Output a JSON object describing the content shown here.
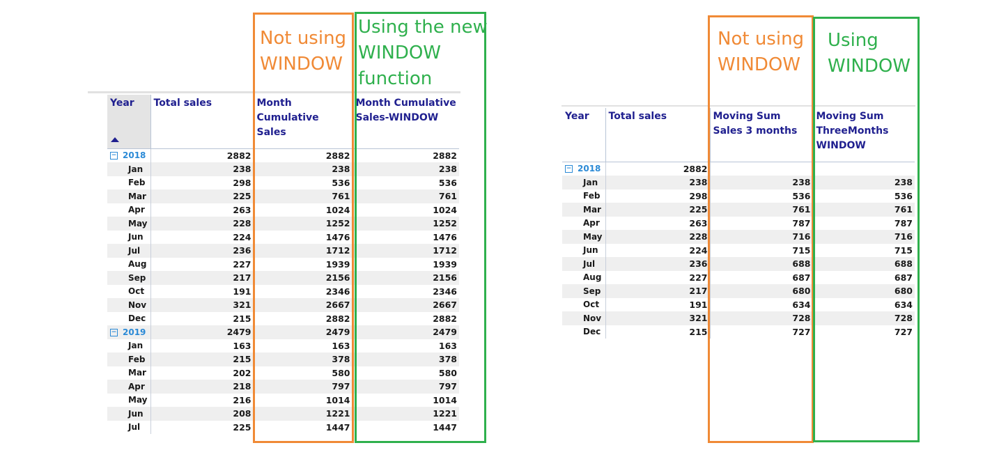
{
  "left": {
    "annotation_orange": [
      "Not using",
      "WINDOW"
    ],
    "annotation_green": [
      "Using the new",
      "WINDOW",
      "function"
    ],
    "headers": [
      "Year",
      "Total sales",
      "Month Cumulative Sales",
      "Month Cumulative Sales-WINDOW"
    ],
    "rows": [
      {
        "type": "year",
        "label": "2018",
        "values": [
          "2882",
          "2882",
          "2882"
        ]
      },
      {
        "type": "month",
        "label": "Jan",
        "values": [
          "238",
          "238",
          "238"
        ]
      },
      {
        "type": "month",
        "label": "Feb",
        "values": [
          "298",
          "536",
          "536"
        ]
      },
      {
        "type": "month",
        "label": "Mar",
        "values": [
          "225",
          "761",
          "761"
        ]
      },
      {
        "type": "month",
        "label": "Apr",
        "values": [
          "263",
          "1024",
          "1024"
        ]
      },
      {
        "type": "month",
        "label": "May",
        "values": [
          "228",
          "1252",
          "1252"
        ]
      },
      {
        "type": "month",
        "label": "Jun",
        "values": [
          "224",
          "1476",
          "1476"
        ]
      },
      {
        "type": "month",
        "label": "Jul",
        "values": [
          "236",
          "1712",
          "1712"
        ]
      },
      {
        "type": "month",
        "label": "Aug",
        "values": [
          "227",
          "1939",
          "1939"
        ]
      },
      {
        "type": "month",
        "label": "Sep",
        "values": [
          "217",
          "2156",
          "2156"
        ]
      },
      {
        "type": "month",
        "label": "Oct",
        "values": [
          "191",
          "2346",
          "2346"
        ]
      },
      {
        "type": "month",
        "label": "Nov",
        "values": [
          "321",
          "2667",
          "2667"
        ]
      },
      {
        "type": "month",
        "label": "Dec",
        "values": [
          "215",
          "2882",
          "2882"
        ]
      },
      {
        "type": "year",
        "label": "2019",
        "values": [
          "2479",
          "2479",
          "2479"
        ]
      },
      {
        "type": "month",
        "label": "Jan",
        "values": [
          "163",
          "163",
          "163"
        ]
      },
      {
        "type": "month",
        "label": "Feb",
        "values": [
          "215",
          "378",
          "378"
        ]
      },
      {
        "type": "month",
        "label": "Mar",
        "values": [
          "202",
          "580",
          "580"
        ]
      },
      {
        "type": "month",
        "label": "Apr",
        "values": [
          "218",
          "797",
          "797"
        ]
      },
      {
        "type": "month",
        "label": "May",
        "values": [
          "216",
          "1014",
          "1014"
        ]
      },
      {
        "type": "month",
        "label": "Jun",
        "values": [
          "208",
          "1221",
          "1221"
        ]
      },
      {
        "type": "month",
        "label": "Jul",
        "values": [
          "225",
          "1447",
          "1447"
        ]
      }
    ]
  },
  "right": {
    "annotation_orange": [
      "Not using",
      "WINDOW"
    ],
    "annotation_green": [
      "Using",
      "WINDOW"
    ],
    "headers": [
      "Year",
      "Total sales",
      "Moving Sum Sales 3 months",
      "Moving Sum ThreeMonths WINDOW"
    ],
    "rows": [
      {
        "type": "year",
        "label": "2018",
        "values": [
          "2882",
          "",
          ""
        ]
      },
      {
        "type": "month",
        "label": "Jan",
        "values": [
          "238",
          "238",
          "238"
        ]
      },
      {
        "type": "month",
        "label": "Feb",
        "values": [
          "298",
          "536",
          "536"
        ]
      },
      {
        "type": "month",
        "label": "Mar",
        "values": [
          "225",
          "761",
          "761"
        ]
      },
      {
        "type": "month",
        "label": "Apr",
        "values": [
          "263",
          "787",
          "787"
        ]
      },
      {
        "type": "month",
        "label": "May",
        "values": [
          "228",
          "716",
          "716"
        ]
      },
      {
        "type": "month",
        "label": "Jun",
        "values": [
          "224",
          "715",
          "715"
        ]
      },
      {
        "type": "month",
        "label": "Jul",
        "values": [
          "236",
          "688",
          "688"
        ]
      },
      {
        "type": "month",
        "label": "Aug",
        "values": [
          "227",
          "687",
          "687"
        ]
      },
      {
        "type": "month",
        "label": "Sep",
        "values": [
          "217",
          "680",
          "680"
        ]
      },
      {
        "type": "month",
        "label": "Oct",
        "values": [
          "191",
          "634",
          "634"
        ]
      },
      {
        "type": "month",
        "label": "Nov",
        "values": [
          "321",
          "728",
          "728"
        ]
      },
      {
        "type": "month",
        "label": "Dec",
        "values": [
          "215",
          "727",
          "727"
        ]
      }
    ]
  },
  "colors": {
    "orange": "#f08a36",
    "green": "#2fb04d",
    "header_text": "#1f1f8f",
    "year_text": "#2b8ad6"
  },
  "icons": {
    "sort": "sort-ascending-icon",
    "expand": "collapse-minus-icon"
  }
}
